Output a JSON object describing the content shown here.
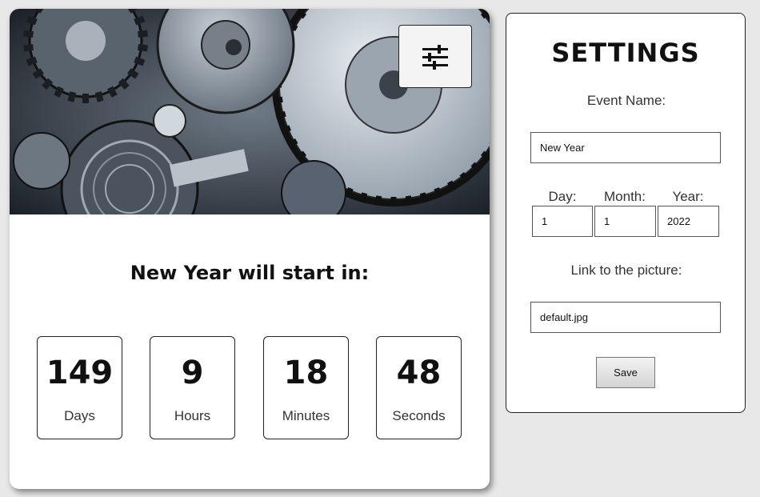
{
  "countdown": {
    "heading": "New Year will start in:",
    "units": [
      {
        "value": "149",
        "label": "Days"
      },
      {
        "value": "9",
        "label": "Hours"
      },
      {
        "value": "18",
        "label": "Minutes"
      },
      {
        "value": "48",
        "label": "Seconds"
      }
    ],
    "settings_button_icon": "sliders-icon"
  },
  "hero": {
    "image_subject": "clockwork gears photo (grayscale)"
  },
  "settings": {
    "title": "SETTINGS",
    "event_name_label": "Event Name:",
    "event_name_value": "New Year",
    "day_label": "Day:",
    "day_value": "1",
    "month_label": "Month:",
    "month_value": "1",
    "year_label": "Year:",
    "year_value": "2022",
    "picture_label": "Link to the picture:",
    "picture_value": "default.jpg",
    "save_label": "Save"
  },
  "colors": {
    "background": "#e8e8e8",
    "card": "#ffffff",
    "text": "#111111"
  }
}
